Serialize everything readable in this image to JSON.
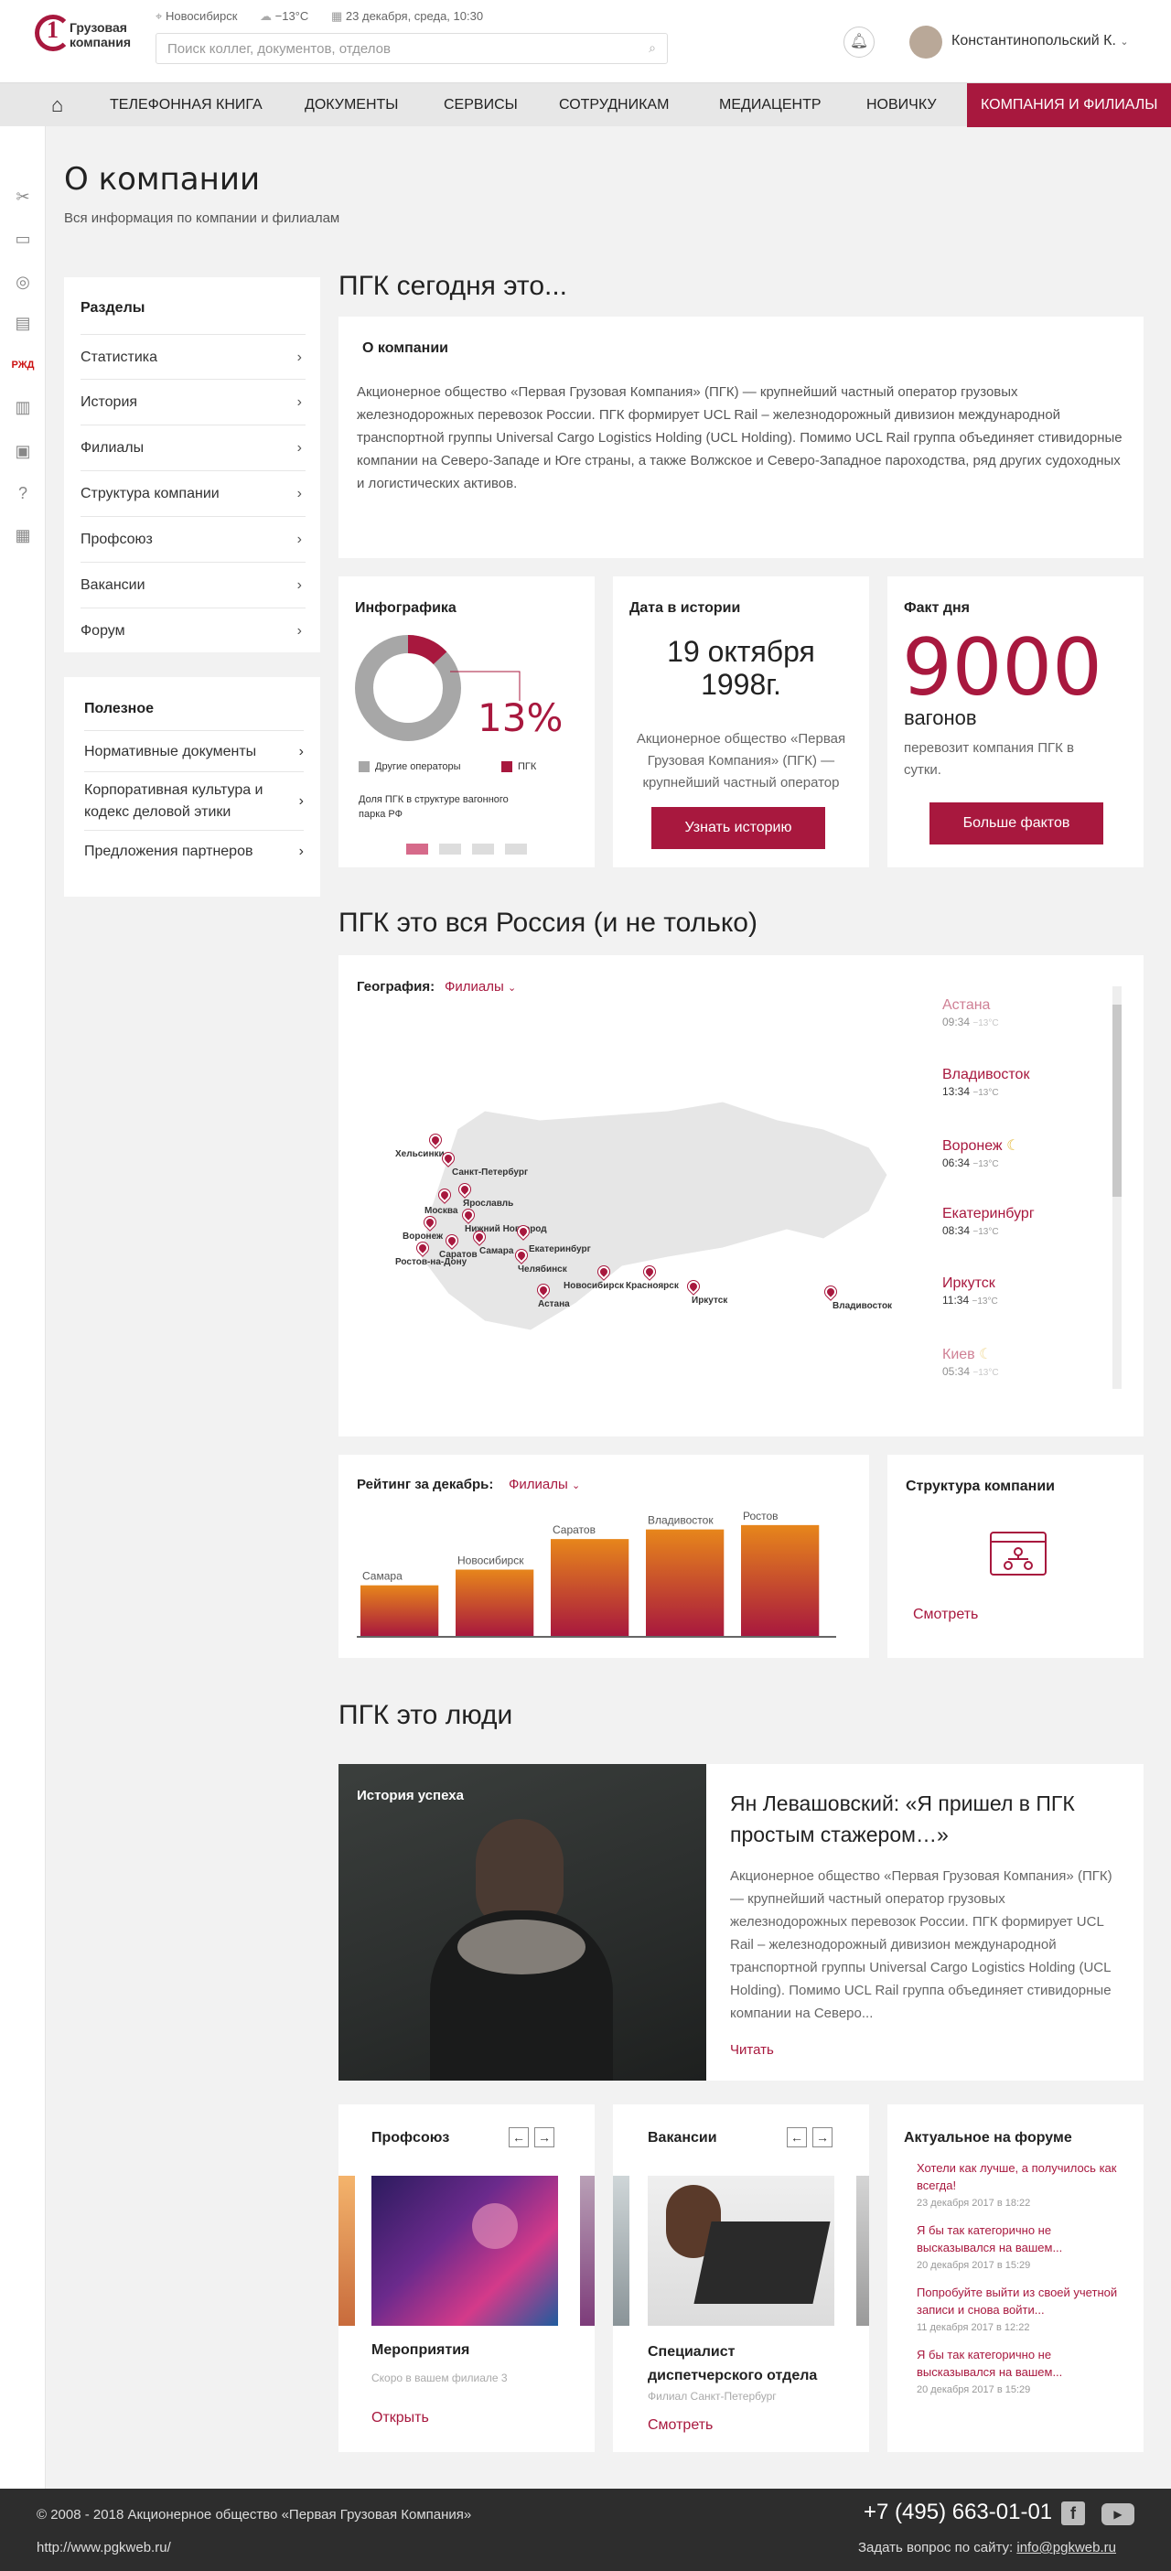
{
  "header": {
    "logo_text_line1": "Грузовая",
    "logo_text_line2": "компания",
    "city": "Новосибирск",
    "weather": "−13°C",
    "date": "23 декабря, среда, 10:30",
    "search_placeholder": "Поиск коллег, документов, отделов",
    "user_name": "Константинопольский К."
  },
  "nav": {
    "items": [
      "ТЕЛЕФОННАЯ КНИГА",
      "ДОКУМЕНТЫ",
      "СЕРВИСЫ",
      "СОТРУДНИКАМ",
      "МЕДИАЦЕНТР",
      "НОВИЧКУ",
      "КОМПАНИЯ И ФИЛИАЛЫ"
    ]
  },
  "page": {
    "title": "О компании",
    "subtitle": "Вся информация по компании и филиалам"
  },
  "sidebar": {
    "sections_title": "Разделы",
    "sections": [
      "Статистика",
      "История",
      "Филиалы",
      "Структура компании",
      "Профсоюз",
      "Вакансии",
      "Форум"
    ],
    "useful_title": "Полезное",
    "useful": [
      "Нормативные документы",
      "Корпоративная культура и кодекс деловой этики",
      "Предложения партнеров"
    ]
  },
  "today": {
    "heading": "ПГК сегодня это...",
    "card_title": "О компании",
    "text": "Акционерное общество «Первая Грузовая Компания» (ПГК) — крупнейший частный оператор грузовых железнодорожных перевозок России. ПГК формирует UCL Rail – железнодорожный дивизион международной транспортной группы Universal Cargo Logistics Holding (UCL Holding). Помимо UCL Rail группа объединяет стивидорные компании на Северо-Западе и Юге страны, а также Волжское и Северо-Западное пароходства, ряд других судоходных и логистических активов."
  },
  "infographic": {
    "title": "Инфографика",
    "percent_label": "13%",
    "share_value": 13,
    "legend_other": "Другие операторы",
    "legend_pgk": "ПГК",
    "caption": "Доля ПГК в структуре вагонного парка РФ",
    "colors": {
      "other": "#a7a7a7",
      "pgk": "#a8183e"
    }
  },
  "history": {
    "title": "Дата в истории",
    "date_line1": "19 октября",
    "date_line2": "1998г.",
    "text": "Акционерное общество «Первая Грузовая Компания» (ПГК) — крупнейший частный оператор",
    "button": "Узнать историю"
  },
  "fact": {
    "title": "Факт дня",
    "number": "9000",
    "unit": "вагонов",
    "text": "перевозит компания ПГК в сутки.",
    "button": "Больше фактов"
  },
  "russia": {
    "heading": "ПГК это вся Россия (и не только)",
    "geo_label": "География:",
    "geo_select": "Филиалы",
    "map_labels": [
      "Хельсинки",
      "Санкт-Петербург",
      "Ярославль",
      "Москва",
      "Нижний Новгород",
      "Воронеж",
      "Саратов",
      "Самара",
      "Екатеринбург",
      "Ростов-на-Дону",
      "Челябинск",
      "Астана",
      "Новосибирск",
      "Красноярск",
      "Иркутск",
      "Владивосток"
    ],
    "cities": [
      {
        "name": "Астана",
        "time": "09:34",
        "temp": "−13°С"
      },
      {
        "name": "Владивосток",
        "time": "13:34",
        "temp": "−13°С"
      },
      {
        "name": "Воронеж",
        "time": "06:34",
        "temp": "−13°С"
      },
      {
        "name": "Екатеринбург",
        "time": "08:34",
        "temp": "−13°С"
      },
      {
        "name": "Иркутск",
        "time": "11:34",
        "temp": "−13°С"
      },
      {
        "name": "Киев",
        "time": "05:34",
        "temp": "−13°С"
      }
    ]
  },
  "rating": {
    "title": "Рейтинг за декабрь:",
    "select": "Филиалы",
    "chart_data": {
      "type": "bar",
      "categories": [
        "Самара",
        "Новосибирск",
        "Саратов",
        "Владивосток",
        "Ростов"
      ],
      "values": [
        58,
        76,
        111,
        122,
        127
      ],
      "ylim": [
        0,
        130
      ]
    }
  },
  "structure": {
    "title": "Структура компании",
    "link": "Смотреть"
  },
  "people": {
    "heading": "ПГК это люди",
    "badge": "История успеха",
    "title": "Ян Левашовский: «Я пришел в ПГК простым стажером…»",
    "text": "Акционерное общество «Первая Грузовая Компания» (ПГК) — крупнейший частный оператор грузовых железнодорожных перевозок России. ПГК формирует UCL Rail – железнодорожный дивизион международной транспортной группы Universal Cargo Logistics Holding (UCL Holding). Помимо UCL Rail группа объединяет стивидорные компании на Северо...",
    "link": "Читать"
  },
  "union": {
    "title": "Профсоюз",
    "item_title": "Мероприятия",
    "item_sub": "Скоро в вашем филиале 3",
    "link": "Открыть"
  },
  "vacancies": {
    "title": "Вакансии",
    "item_title": "Специалист диспетчерского отдела",
    "item_sub": "Филиал Санкт-Петербург",
    "link": "Смотреть"
  },
  "forum": {
    "title": "Актуальное на форуме",
    "posts": [
      {
        "text": "Хотели как лучше, а получилось как всегда!",
        "date": "23 декабря 2017 в 18:22"
      },
      {
        "text": "Я бы так категорично не высказывался на вашем...",
        "date": "20 декабря 2017 в 15:29"
      },
      {
        "text": "Попробуйте выйти из своей учетной записи и снова войти...",
        "date": "11 декабря 2017 в 12:22"
      },
      {
        "text": "Я бы так категорично не высказывался на вашем...",
        "date": "20 декабря 2017 в 15:29"
      }
    ]
  },
  "footer": {
    "copyright": "© 2008 - 2018 Акционерное общество «Первая Грузовая Компания»",
    "url": "http://www.pgkweb.ru/",
    "phone": "+7 (495) 663-01-01",
    "ask": "Задать вопрос по сайту:",
    "email": "info@pgkweb.ru"
  }
}
